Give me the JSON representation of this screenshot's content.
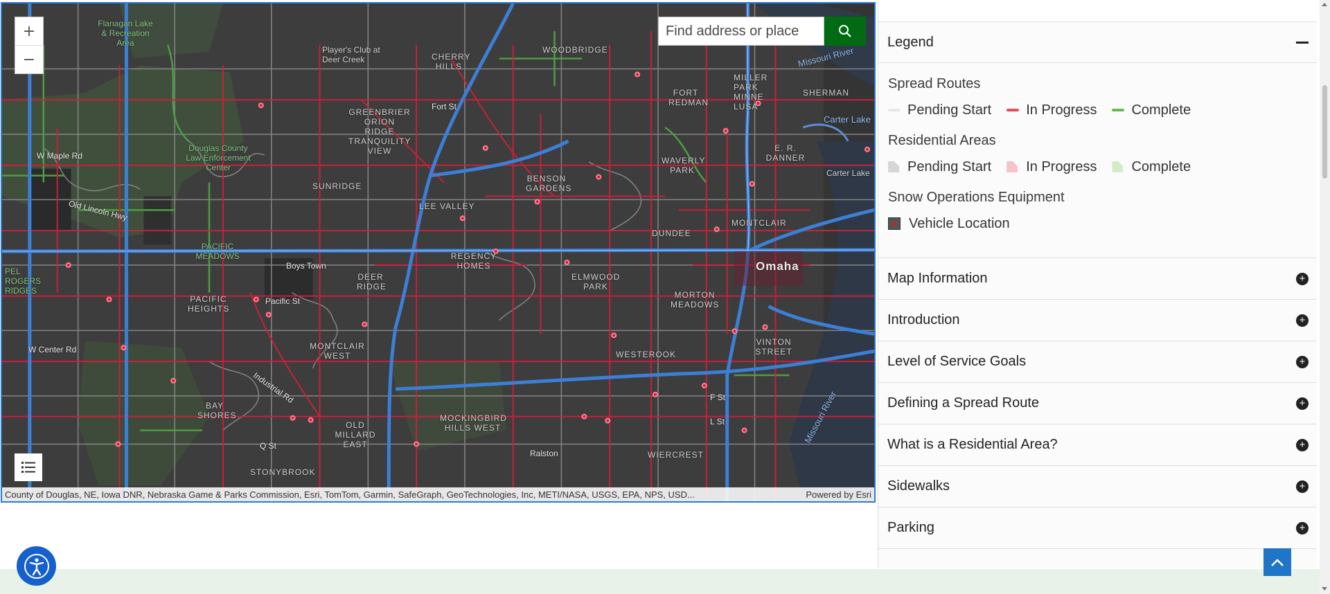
{
  "map": {
    "search_placeholder": "Find address or place",
    "zoom_in": "+",
    "zoom_out": "−",
    "attribution": "County of Douglas, NE, Iowa DNR, Nebraska Game & Parks Commission, Esri, TomTom, Garmin, SafeGraph, GeoTechnologies, Inc, METI/NASA, USGS, EPA, NPS, USD...",
    "powered_by": "Powered by Esri",
    "labels": {
      "omaha": "Omaha",
      "boys_town": "Boys Town",
      "ralston": "Ralston",
      "w_maple": "W Maple Rd",
      "w_center": "W Center Rd",
      "old_lincoln": "Old Lincoln Hwy",
      "pacific_st": "Pacific St",
      "fort_st": "Fort St",
      "f_st": "F St",
      "l_st": "L St",
      "q_st": "Q St",
      "industrial": "Industrial Rd",
      "missouri1": "Missouri River",
      "missouri2": "Missouri River",
      "carter_lake": "Carter Lake",
      "carter_lake2": "Carter Lake",
      "flanagan": "Flanagan Lake & Recreation Area",
      "players_club": "Player's Club at Deer Creek",
      "lee_valley": "LEE VALLEY",
      "regency": "REGENCY HOMES",
      "elmwood": "ELMWOOD PARK",
      "dundee": "DUNDEE",
      "westerook": "WESTEROOK",
      "mockingbird": "MOCKINGBIRD HILLS WEST",
      "bay_shores": "BAY SHORES",
      "stonybrook": "STONYBROOK",
      "morton": "MORTON MEADOWS",
      "montclair": "MONTCLAIR",
      "sunridge": "SUNRIDGE",
      "pacific_meadows": "PACIFIC MEADOWS",
      "pacific_heights": "PACIFIC HEIGHTS",
      "deer_ridge": "DEER RIDGE",
      "montclair_west": "MONTCLAIR WEST",
      "old_millard": "OLD MILLARD EAST",
      "benson": "BENSON GARDENS",
      "waverly": "WAVERLY PARK",
      "cherry_hills": "CHERRY HILLS",
      "woodbridge": "WOODBRIDGE",
      "miller_park": "MILLER PARK MINNE LUSA",
      "fort_redman": "FORT REDMAN",
      "sherman": "SHERMAN",
      "danner": "E. R. DANNER",
      "vinton": "VINTON STREET",
      "wiercrest": "WIERCREST",
      "greenbrier": "GREENBRIER ORION RIDGE TRANQUILITY VIEW",
      "douglas_county": "Douglas County Law Enforcement Center",
      "rogers": "PEL ROGERS RIDGES"
    }
  },
  "panel": {
    "legend_title": "Legend",
    "spread_routes": {
      "title": "Spread Routes",
      "items": [
        {
          "label": "Pending Start",
          "color": "#e8e8e8"
        },
        {
          "label": "In Progress",
          "color": "#ef4b57"
        },
        {
          "label": "Complete",
          "color": "#5fbf4a"
        }
      ]
    },
    "residential_areas": {
      "title": "Residential Areas",
      "items": [
        {
          "label": "Pending Start",
          "color": "#d6d6d6"
        },
        {
          "label": "In Progress",
          "color": "#f6c4c8"
        },
        {
          "label": "Complete",
          "color": "#d2ecc9"
        }
      ]
    },
    "snow_equipment": {
      "title": "Snow Operations Equipment",
      "items": [
        {
          "label": "Vehicle Location"
        }
      ]
    },
    "sections": [
      "Map Information",
      "Introduction",
      "Level of Service Goals",
      "Defining a Spread Route",
      "What is a Residential Area?",
      "Sidewalks",
      "Parking"
    ]
  }
}
